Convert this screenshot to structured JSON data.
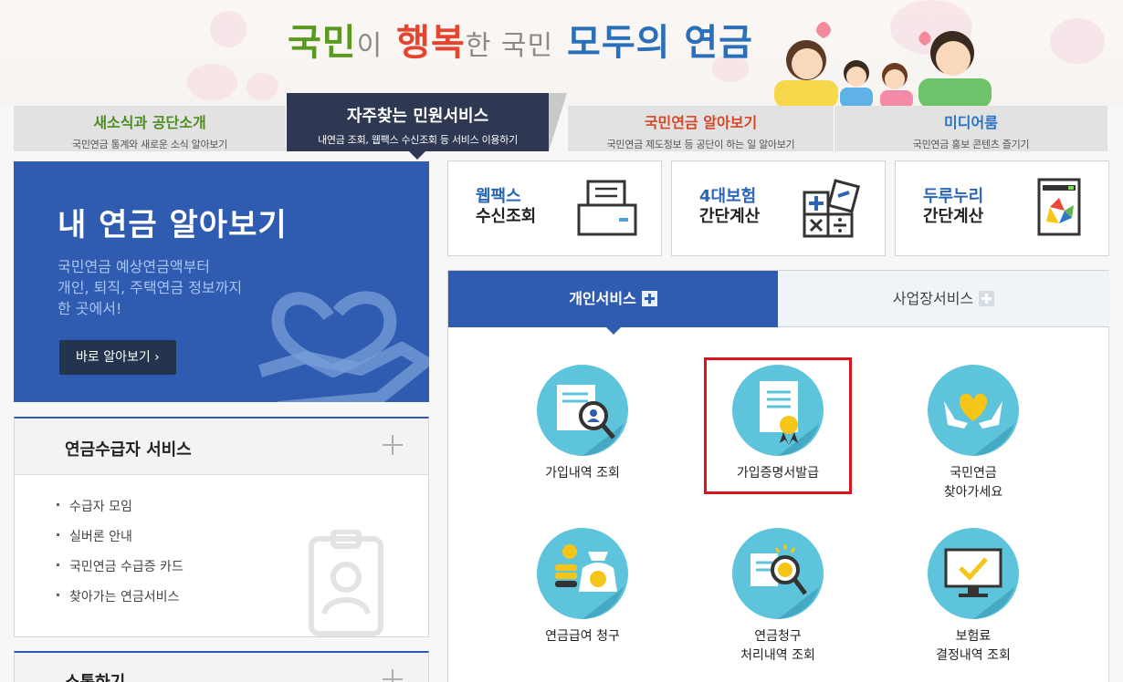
{
  "banner": {
    "title_part1": "국민",
    "title_part2": "이",
    "title_part3": "행복",
    "title_part4": "한 국민",
    "title_part5": "모두의 연금"
  },
  "topnav": {
    "tabs": [
      {
        "title": "새소식과 공단소개",
        "sub": "국민연금 통계와 새로운 소식 알아보기"
      },
      {
        "title": "자주찾는 민원서비스",
        "sub": "내연금 조회, 웹팩스 수신조회 등 서비스 이용하기"
      },
      {
        "title": "국민연금 알아보기",
        "sub": "국민연금 제도정보 등 공단이 하는 일 알아보기"
      },
      {
        "title": "미디어룸",
        "sub": "국민연금 홍보 콘텐츠 즐기기"
      }
    ]
  },
  "hero": {
    "title": "내 연금 알아보기",
    "desc": [
      "국민연금 예상연금액부터",
      "개인, 퇴직, 주택연금 정보까지",
      "한 곳에서!"
    ],
    "button": "바로 알아보기 ›"
  },
  "pensioner": {
    "title": "연금수급자 서비스",
    "items": [
      "수급자 모임",
      "실버론 안내",
      "국민연금 수급증 카드",
      "찾아가는 연금서비스"
    ]
  },
  "communication": {
    "title": "소통하기"
  },
  "quick": [
    {
      "line1": "웹팩스",
      "line2": "수신조회",
      "icon": "fax-icon"
    },
    {
      "line1": "4대보험",
      "line2": "간단계산",
      "icon": "calculator-icon"
    },
    {
      "line1": "두루누리",
      "line2": "간단계산",
      "icon": "durunuri-icon"
    }
  ],
  "panel": {
    "tab_personal": "개인서비스",
    "tab_business": "사업장서비스",
    "items": [
      {
        "line1": "가입내역 조회",
        "line2": "",
        "icon": "document-search-icon"
      },
      {
        "line1": "가입증명서발급",
        "line2": "",
        "icon": "certificate-icon"
      },
      {
        "line1": "국민연금",
        "line2": "찾아가세요",
        "icon": "heart-hands-icon"
      },
      {
        "line1": "연금급여 청구",
        "line2": "",
        "icon": "coins-bag-icon"
      },
      {
        "line1": "연금청구",
        "line2": "처리내역 조회",
        "icon": "claim-search-icon"
      },
      {
        "line1": "보험료",
        "line2": "결정내역 조회",
        "icon": "monitor-check-icon"
      }
    ]
  },
  "colors": {
    "primary_blue": "#2f5bb0",
    "navy": "#2f3852",
    "green": "#4e8c21",
    "orange_red": "#d2492a",
    "highlight_red": "#d7141e",
    "circle_teal": "#5ec4db"
  }
}
